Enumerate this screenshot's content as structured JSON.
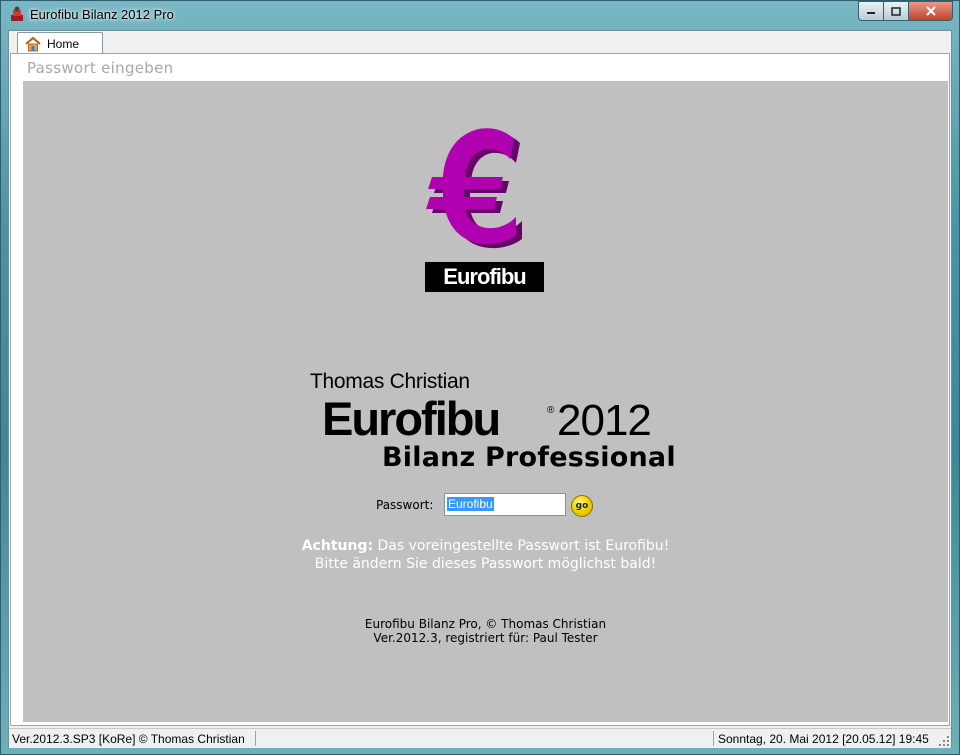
{
  "window": {
    "title": "Eurofibu Bilanz 2012 Pro",
    "controls": [
      "minimize",
      "maximize",
      "close"
    ]
  },
  "tabs": [
    {
      "label": "Home",
      "icon": "home-icon",
      "active": true
    }
  ],
  "panel": {
    "title": "Passwort eingeben"
  },
  "logo": {
    "label": "Eurofibu",
    "icon": "euro-icon",
    "color": "#b000b0"
  },
  "brand": {
    "author": "Thomas Christian",
    "name": "Eurofibu",
    "registered": "®",
    "year": "2012",
    "product": "Bilanz Professional"
  },
  "login": {
    "label": "Passwort:",
    "value": "Eurofibu",
    "go_label": "go"
  },
  "warning": {
    "strong": "Achtung:",
    "line1": "Das voreingestellte Passwort ist Eurofibu!",
    "line2": "Bitte ändern Sie dieses Passwort möglichst bald!"
  },
  "copyright": {
    "line1": "Eurofibu Bilanz Pro, © Thomas Christian",
    "line2": "Ver.2012.3, registriert für: Paul Tester"
  },
  "status": {
    "left": "Ver.2012.3.SP3 [KoRe] © Thomas Christian",
    "right": "Sonntag, 20. Mai 2012  [20.05.12]  19:45"
  }
}
